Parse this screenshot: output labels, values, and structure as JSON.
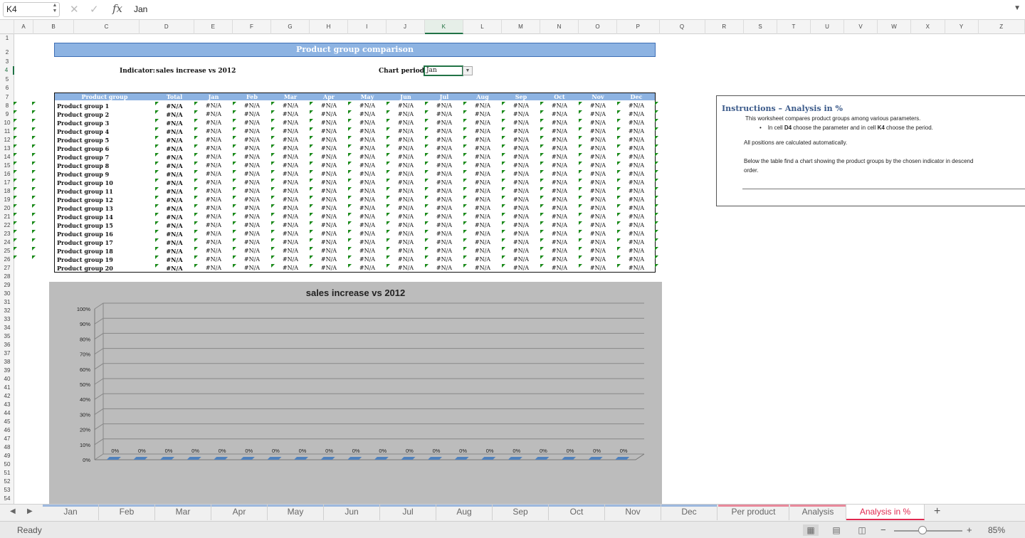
{
  "formula_bar": {
    "name_box": "K4",
    "fx": "fx",
    "value": "Jan",
    "cancel_icon": "✕",
    "enter_icon": "✓"
  },
  "columns": [
    "A",
    "B",
    "C",
    "D",
    "E",
    "F",
    "G",
    "H",
    "I",
    "J",
    "K",
    "L",
    "M",
    "N",
    "O",
    "P",
    "Q",
    "R",
    "S",
    "T",
    "U",
    "V",
    "W",
    "X",
    "Y",
    "Z"
  ],
  "selected_column": "K",
  "rows": [
    "1",
    "2",
    "3",
    "4",
    "5",
    "6",
    "7",
    "8",
    "9",
    "10",
    "11",
    "12",
    "13",
    "14",
    "15",
    "16",
    "17",
    "18",
    "19",
    "20",
    "21",
    "22",
    "23",
    "24",
    "25",
    "26",
    "27",
    "28",
    "29",
    "30",
    "31",
    "32",
    "33",
    "34",
    "35",
    "36",
    "37",
    "38",
    "39",
    "40",
    "41",
    "42",
    "43",
    "44",
    "45",
    "46",
    "47",
    "48",
    "49",
    "50",
    "51",
    "52",
    "53",
    "54"
  ],
  "selected_row": "4",
  "sheet": {
    "title": "Product group comparison",
    "indicator_label": "Indicator:",
    "indicator_value": "sales increase vs 2012",
    "chart_period_label": "Chart period:",
    "chart_period_value": "Jan",
    "table": {
      "headers": [
        "Product group",
        "Total",
        "Jan",
        "Feb",
        "Mar",
        "Apr",
        "May",
        "Jun",
        "Jul",
        "Aug",
        "Sep",
        "Oct",
        "Nov",
        "Dec"
      ],
      "groups": [
        "Product group 1",
        "Product group 2",
        "Product group 3",
        "Product group 4",
        "Product group 5",
        "Product group 6",
        "Product group 7",
        "Product group 8",
        "Product group 9",
        "Product group 10",
        "Product group 11",
        "Product group 12",
        "Product group 13",
        "Product group 14",
        "Product group 15",
        "Product group 16",
        "Product group 17",
        "Product group 18",
        "Product group 19",
        "Product group 20"
      ],
      "cell_value": "#N/A"
    }
  },
  "instructions": {
    "title": "Instructions – Analysis in %",
    "line1": "This worksheet compares product groups among various parameters.",
    "bullet_pre": "In cell ",
    "bullet_d4": "D4",
    "bullet_mid": " choose the parameter and in cell ",
    "bullet_k4": "K4",
    "bullet_post": " choose the period.",
    "line2": "All positions are calculated automatically.",
    "line3": "Below the table find a chart showing the product groups by the chosen indicator in descend",
    "line3b": "order."
  },
  "chart_data": {
    "type": "bar",
    "title": "sales increase vs 2012",
    "xlabel": "",
    "ylabel": "",
    "ylim": [
      0,
      1
    ],
    "yticks": [
      "0%",
      "10%",
      "20%",
      "30%",
      "40%",
      "50%",
      "60%",
      "70%",
      "80%",
      "90%",
      "100%"
    ],
    "categories": [
      "",
      "",
      "",
      "",
      "",
      "",
      "",
      "",
      "",
      "",
      "",
      "",
      "",
      "",
      "",
      "",
      "",
      "",
      "",
      ""
    ],
    "values": [
      0,
      0,
      0,
      0,
      0,
      0,
      0,
      0,
      0,
      0,
      0,
      0,
      0,
      0,
      0,
      0,
      0,
      0,
      0,
      0
    ],
    "data_labels": [
      "0%",
      "0%",
      "0%",
      "0%",
      "0%",
      "0%",
      "0%",
      "0%",
      "0%",
      "0%",
      "0%",
      "0%",
      "0%",
      "0%",
      "0%",
      "0%",
      "0%",
      "0%",
      "0%",
      "0%"
    ],
    "grid": true,
    "bar_color": "#4f81bd"
  },
  "tabs": [
    "Jan",
    "Feb",
    "Mar",
    "Apr",
    "May",
    "Jun",
    "Jul",
    "Aug",
    "Sep",
    "Oct",
    "Nov",
    "Dec",
    "Per product",
    "Analysis",
    "Analysis in %"
  ],
  "active_tab": "Analysis in %",
  "colors": {
    "accent": "#217346",
    "header_blue": "#8db3e2",
    "active_tab": "#e0284f",
    "month_tab_stripe": "#9db8de",
    "analysis_tab_stripe": "#e8899b"
  },
  "status": {
    "ready": "Ready",
    "zoom": "85%",
    "zoom_minus": "−",
    "zoom_plus": "+"
  }
}
